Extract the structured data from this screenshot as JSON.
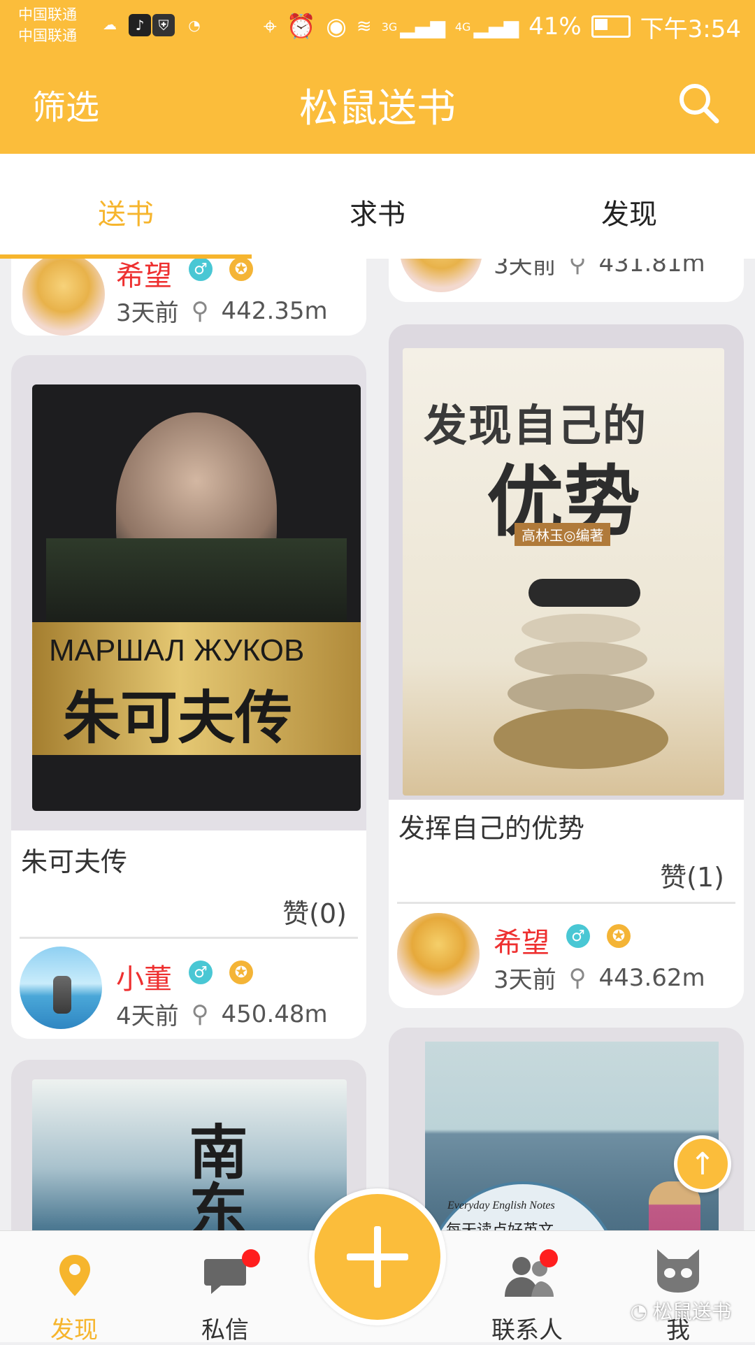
{
  "status_bar": {
    "carrier_1": "中国联通",
    "carrier_2": "中国联通",
    "network_3g": "3G",
    "network_4g": "4G",
    "battery": "41%",
    "time": "下午3:54"
  },
  "header": {
    "filter_label": "筛选",
    "title": "松鼠送书",
    "search_icon": "search-icon"
  },
  "tabs": [
    {
      "label": "送书",
      "active": true
    },
    {
      "label": "求书"
    },
    {
      "label": "发现"
    }
  ],
  "feed": {
    "cards": [
      {
        "user": "希望",
        "time_ago": "3天前",
        "distance": "442.35m"
      },
      {
        "time_ago": "3天前",
        "distance": "431.81m"
      },
      {
        "cover_title": "МАРШАЛ ЖУКОВ",
        "cover_title_cn": "朱可夫传",
        "title": "朱可夫传",
        "likes": "赞(0)",
        "user": "小董",
        "time_ago": "4天前",
        "distance": "450.48m"
      },
      {
        "cover_title": "发现自己的",
        "cover_title_2": "优势",
        "cover_author": "高林玉◎编著",
        "title": "发挥自己的优势",
        "likes": "赞(1)",
        "user": "希望",
        "time_ago": "3天前",
        "distance": "443.62m"
      },
      {
        "cover_text": "南东"
      },
      {
        "cover_text": "Everyday English Notes",
        "cover_text_cn": "每天读点好英文"
      }
    ]
  },
  "bottom_nav": [
    {
      "label": "发现",
      "icon": "location-pin-icon",
      "active": true
    },
    {
      "label": "私信",
      "icon": "message-icon",
      "badge": true
    },
    {
      "label": "add",
      "icon": "plus-icon"
    },
    {
      "label": "联系人",
      "icon": "contacts-icon",
      "badge": true
    },
    {
      "label": "我",
      "icon": "cat-face-icon"
    }
  ],
  "watermark": "松鼠送书",
  "colors": {
    "accent": "#fbbd3b",
    "active_tab": "#f6b52d",
    "username": "#ee3030",
    "badge_red": "#ff1e1e"
  }
}
